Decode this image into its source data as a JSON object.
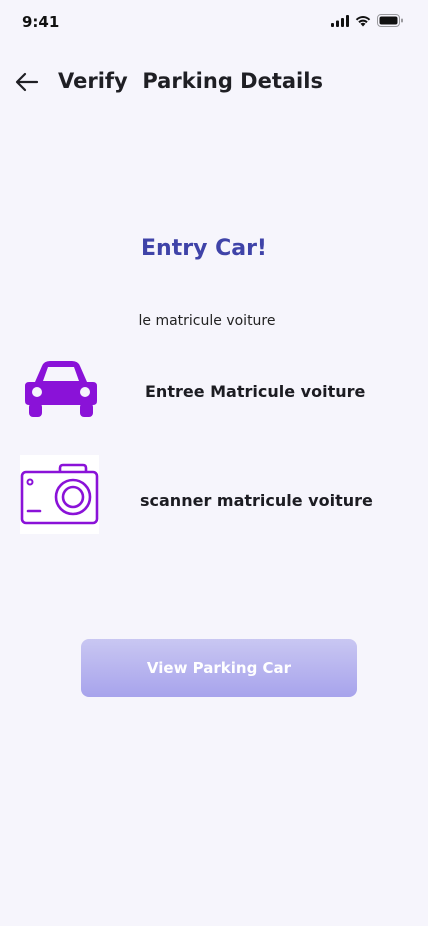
{
  "status_bar": {
    "time": "9:41",
    "icons": [
      "signal-icon",
      "wifi-icon",
      "battery-icon"
    ]
  },
  "header": {
    "back_icon": "arrow-left-icon",
    "title": "Verify  Parking Details"
  },
  "content": {
    "heading": "Entry Car!",
    "subtitle": "le matricule voiture",
    "options": [
      {
        "icon": "car-icon",
        "label": "Entree Matricule voiture"
      },
      {
        "icon": "camera-icon",
        "label": "scanner matricule voiture"
      }
    ]
  },
  "actions": {
    "view_button_label": "View Parking Car"
  },
  "colors": {
    "background": "#f6f5fc",
    "heading": "#3f43a8",
    "icon_accent": "#8a12d8",
    "button_gradient_top": "#c9c7f2",
    "button_gradient_bottom": "#a7a3ec"
  }
}
